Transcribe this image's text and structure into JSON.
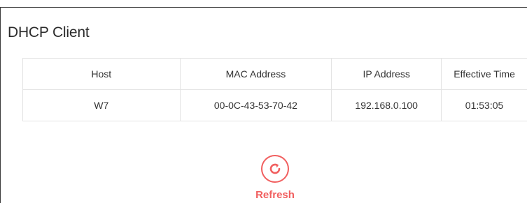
{
  "page": {
    "title": "DHCP Client"
  },
  "table": {
    "headers": {
      "host": "Host",
      "mac": "MAC Address",
      "ip": "IP Address",
      "time": "Effective Time"
    },
    "rows": [
      {
        "host": "W7",
        "mac": "00-0C-43-53-70-42",
        "ip": "192.168.0.100",
        "time": "01:53:05"
      }
    ]
  },
  "refresh": {
    "label": "Refresh",
    "icon": "refresh-icon"
  },
  "colors": {
    "accent": "#f15f5f",
    "border": "#e3e3e3"
  }
}
